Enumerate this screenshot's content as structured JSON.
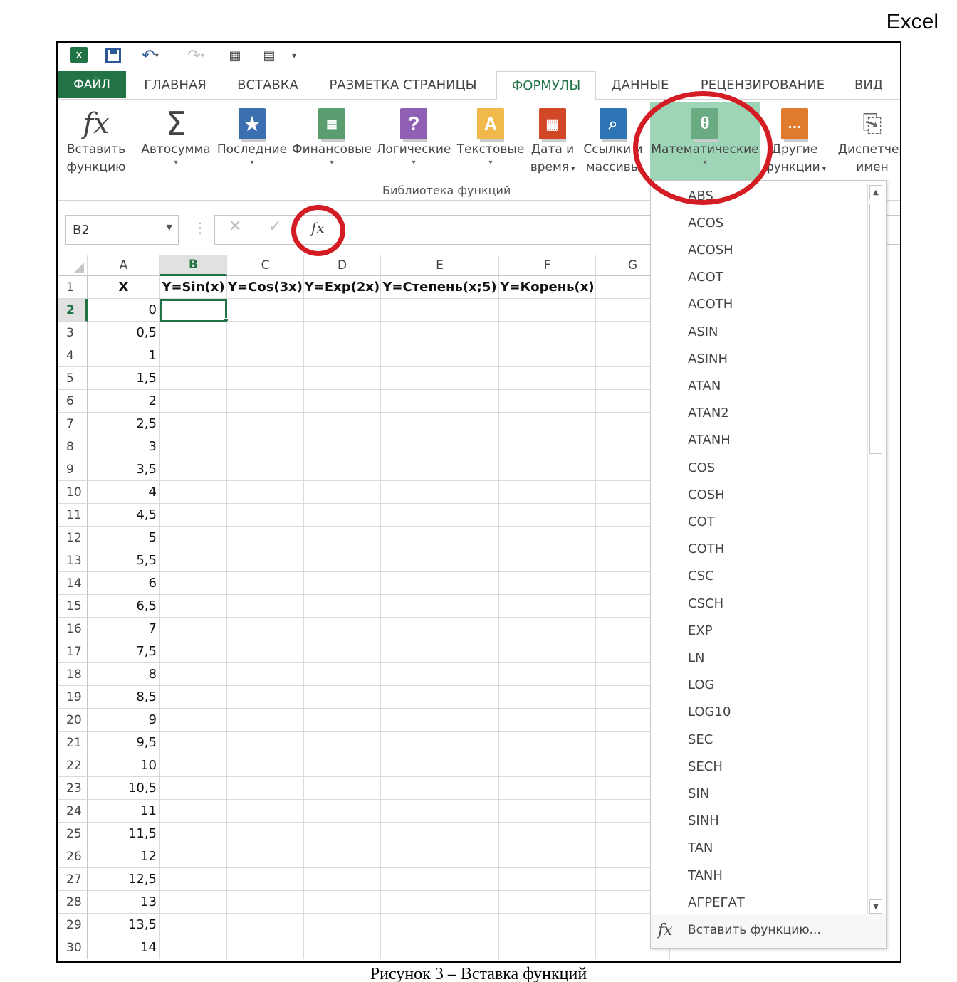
{
  "doc": {
    "title": "Excel",
    "caption": "Рисунок 3 – Вставка функций"
  },
  "qat": {
    "logo": "X",
    "undo_icon": "undo-icon",
    "redo_icon": "redo-icon"
  },
  "tabs": [
    {
      "label": "ФАЙЛ"
    },
    {
      "label": "ГЛАВНАЯ"
    },
    {
      "label": "ВСТАВКА"
    },
    {
      "label": "РАЗМЕТКА СТРАНИЦЫ"
    },
    {
      "label": "ФОРМУЛЫ"
    },
    {
      "label": "ДАННЫЕ"
    },
    {
      "label": "РЕЦЕНЗИРОВАНИЕ"
    },
    {
      "label": "ВИД"
    }
  ],
  "ribbon": {
    "buttons": [
      {
        "line1": "Вставить",
        "line2": "функцию",
        "icon": "fx-icon"
      },
      {
        "line1": "Автосумма",
        "line2": "",
        "icon": "sigma-icon"
      },
      {
        "line1": "Последние",
        "line2": "",
        "icon": "star-book-icon"
      },
      {
        "line1": "Финансовые",
        "line2": "",
        "icon": "coins-book-icon"
      },
      {
        "line1": "Логические",
        "line2": "",
        "icon": "question-book-icon"
      },
      {
        "line1": "Текстовые",
        "line2": "",
        "icon": "text-book-icon"
      },
      {
        "line1": "Дата и",
        "line2": "время",
        "icon": "calendar-book-icon"
      },
      {
        "line1": "Ссылки и",
        "line2": "массивы",
        "icon": "lookup-book-icon"
      },
      {
        "line1": "Математические",
        "line2": "",
        "icon": "theta-book-icon"
      },
      {
        "line1": "Другие",
        "line2": "функции",
        "icon": "more-book-icon"
      },
      {
        "line1": "Диспетчер",
        "line2": "имен",
        "icon": "name-manager-icon"
      }
    ],
    "group_label": "Библиотека функций"
  },
  "formula_bar": {
    "name_box": "B2",
    "formula": ""
  },
  "grid": {
    "columns": [
      "A",
      "B",
      "C",
      "D",
      "E",
      "F",
      "G"
    ],
    "header_row": [
      "X",
      "Y=Sin(x)",
      "Y=Cos(3x)",
      "Y=Exp(2x)",
      "Y=Степень(x;5)",
      "Y=Корень(x)"
    ],
    "row_numbers": [
      "1",
      "2",
      "3",
      "4",
      "5",
      "6",
      "7",
      "8",
      "9",
      "10",
      "11",
      "12",
      "13",
      "14",
      "15",
      "16",
      "17",
      "18",
      "19",
      "20",
      "21",
      "22",
      "23",
      "24",
      "25",
      "26",
      "27",
      "28",
      "29",
      "30"
    ],
    "x_values": [
      "0",
      "0,5",
      "1",
      "1,5",
      "2",
      "2,5",
      "3",
      "3,5",
      "4",
      "4,5",
      "5",
      "5,5",
      "6",
      "6,5",
      "7",
      "7,5",
      "8",
      "8,5",
      "9",
      "9,5",
      "10",
      "10,5",
      "11",
      "11,5",
      "12",
      "12,5",
      "13",
      "13,5",
      "14"
    ],
    "active_cell": "B2"
  },
  "dropdown": {
    "items": [
      "ABS",
      "ACOS",
      "ACOSH",
      "ACOT",
      "ACOTH",
      "ASIN",
      "ASINH",
      "ATAN",
      "ATAN2",
      "ATANH",
      "COS",
      "COSH",
      "COT",
      "COTH",
      "CSC",
      "CSCH",
      "EXP",
      "LN",
      "LOG",
      "LOG10",
      "SEC",
      "SECH",
      "SIN",
      "SINH",
      "TAN",
      "TANH",
      "АГРЕГАТ"
    ],
    "footer_label": "Вставить функцию..."
  },
  "colors": {
    "accent": "#217346",
    "highlight": "#d41c24",
    "selected_button": "#9fd5b7"
  }
}
